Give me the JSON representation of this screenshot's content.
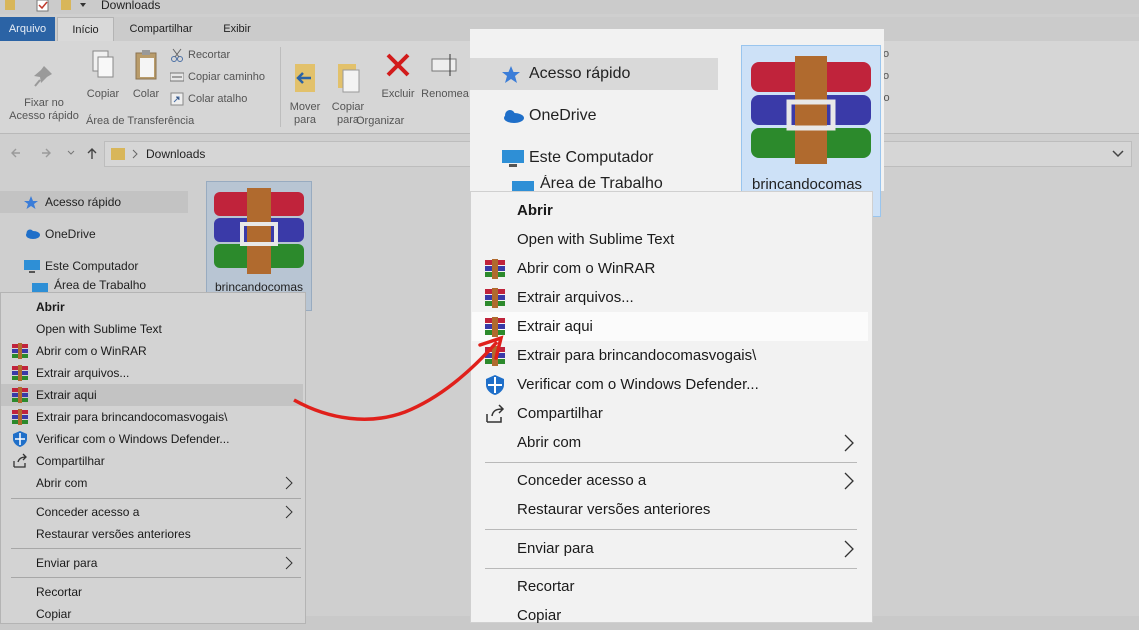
{
  "window": {
    "title": "Downloads"
  },
  "ribbon_tabs": [
    "Arquivo",
    "Início",
    "Compartilhar",
    "Exibir"
  ],
  "ribbon": {
    "pin": "Fixar no\nAcesso rápido",
    "copy": "Copiar",
    "paste": "Colar",
    "cut": "Recortar",
    "copy_path": "Copiar caminho",
    "paste_shortcut": "Colar atalho",
    "clipboard_group": "Área de Transferência",
    "move_to": "Mover\npara",
    "copy_to": "Copiar\npara",
    "delete": "Excluir",
    "rename": "Renomea",
    "organize_group": "Organizar",
    "right_partial": [
      "o",
      "o",
      "io"
    ]
  },
  "address": {
    "path": "Downloads"
  },
  "nav": {
    "quick_access": "Acesso rápido",
    "onedrive": "OneDrive",
    "this_pc": "Este Computador",
    "desktop": "Área de Trabalho"
  },
  "file": {
    "name": "brincandocomas"
  },
  "menu": {
    "items": [
      {
        "label": "Abrir",
        "bold": true,
        "icon": ""
      },
      {
        "label": "Open with Sublime Text",
        "icon": ""
      },
      {
        "label": "Abrir com o WinRAR",
        "icon": "winrar-icon"
      },
      {
        "label": "Extrair arquivos...",
        "icon": "winrar-icon"
      },
      {
        "label": "Extrair aqui",
        "icon": "winrar-icon",
        "highlighted": true
      },
      {
        "label": "Extrair para brincandocomasvogais\\",
        "icon": "winrar-icon"
      },
      {
        "label": "Verificar com o Windows Defender...",
        "icon": "shield-icon"
      },
      {
        "label": "Compartilhar",
        "icon": "share-icon"
      },
      {
        "label": "Abrir com",
        "icon": "",
        "submenu": true
      },
      {
        "label": "Conceder acesso a",
        "icon": "",
        "submenu": true
      },
      {
        "label": "Restaurar versões anteriores",
        "icon": ""
      },
      {
        "label": "Enviar para",
        "icon": "",
        "submenu": true
      },
      {
        "label": "Recortar",
        "icon": ""
      },
      {
        "label": "Copiar",
        "icon": ""
      }
    ]
  },
  "colors": {
    "accent": "#2b63a5",
    "arrow": "#e0201b"
  }
}
